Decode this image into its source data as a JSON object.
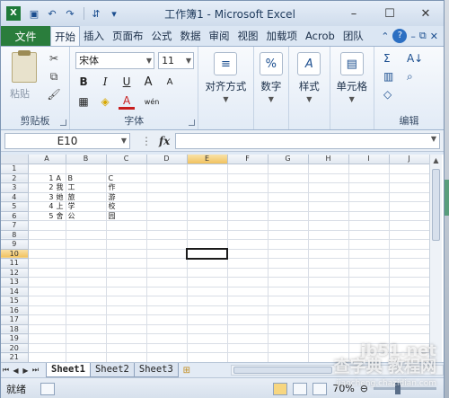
{
  "window": {
    "title": "工作簿1 - Microsoft Excel",
    "minimize": "–",
    "maximize": "☐",
    "close": "✕"
  },
  "tabs": [
    "文件",
    "开始",
    "插入",
    "页面布",
    "公式",
    "数据",
    "审阅",
    "视图",
    "加载项",
    "Acrob",
    "团队"
  ],
  "active_tab": "开始",
  "ribbon": {
    "clipboard": {
      "label": "剪贴板",
      "paste": "粘贴"
    },
    "font": {
      "label": "字体",
      "family": "宋体",
      "size": "11",
      "bold": "B",
      "italic": "I",
      "underline": "U",
      "grow": "A",
      "shrink": "A",
      "wen": "wén",
      "font_color_glyph": "A"
    },
    "alignment": {
      "label": "对齐方式"
    },
    "number": {
      "label": "数字",
      "icon": "%"
    },
    "styles": {
      "label": "样式",
      "icon": "A"
    },
    "cells": {
      "label": "单元格"
    },
    "editing": {
      "label": "编辑",
      "sum": "Σ",
      "sort": "A↓",
      "find": "🔭"
    }
  },
  "formula_bar": {
    "name_box": "E10",
    "fx": "fx",
    "value": ""
  },
  "grid": {
    "columns": [
      "A",
      "B",
      "C",
      "D",
      "E",
      "F",
      "G",
      "H",
      "I",
      "J"
    ],
    "row_count": 22,
    "selected_cell": "E10",
    "cells": [
      [
        "",
        "",
        "",
        "",
        "",
        "",
        "",
        "",
        "",
        ""
      ],
      [
        "",
        "1 A",
        "B",
        "C",
        "",
        "",
        "",
        "",
        "",
        ""
      ],
      [
        "",
        "2 我",
        "工",
        "作",
        "",
        "",
        "",
        "",
        "",
        ""
      ],
      [
        "",
        "3 她",
        "旅",
        "游",
        "",
        "",
        "",
        "",
        "",
        ""
      ],
      [
        "",
        "4 上",
        "学",
        "校",
        "",
        "",
        "",
        "",
        "",
        ""
      ],
      [
        "",
        "5 舍",
        "公",
        "园",
        "",
        "",
        "",
        "",
        "",
        ""
      ]
    ]
  },
  "sheets": [
    "Sheet1",
    "Sheet2",
    "Sheet3"
  ],
  "active_sheet": "Sheet1",
  "status": {
    "ready": "就绪",
    "zoom": "70%"
  },
  "watermark": {
    "line1": "jb51.net",
    "line2": "查字典 教程网",
    "line3": "jiaocheng.chazidian.com"
  }
}
